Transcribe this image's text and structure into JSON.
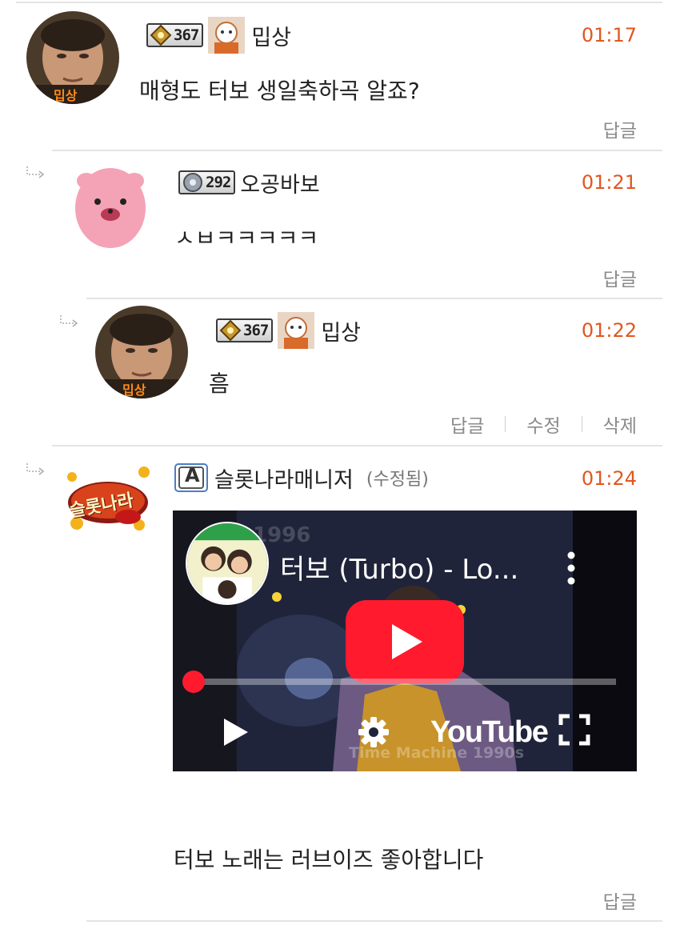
{
  "colors": {
    "time": "#e2561e",
    "text": "#222222",
    "muted": "#8a8a8a",
    "divider": "#e4e4e4",
    "youtube_red": "#ff1a2e"
  },
  "comments": [
    {
      "avatar_tag": "밉상",
      "level": "367",
      "nickname": "밉상",
      "time": "01:17",
      "text": "매형도 터보 생일축하곡 알죠?",
      "actions": [
        "답글"
      ]
    },
    {
      "level": "292",
      "nickname": "오공바보",
      "time": "01:21",
      "text": "ㅅㅂㅋㅋㅋㅋㅋ",
      "actions": [
        "답글"
      ]
    },
    {
      "avatar_tag": "밉상",
      "level": "367",
      "nickname": "밉상",
      "time": "01:22",
      "text": "흠",
      "actions": [
        "답글",
        "수정",
        "삭제"
      ]
    },
    {
      "avatar_tag": "슬롯나라",
      "admin_badge": "A",
      "nickname": "슬롯나라매니저",
      "edited": "(수정됨)",
      "time": "01:24",
      "video": {
        "title": "터보 (Turbo) - Lo...",
        "logo": "YouTube",
        "watermark": "Time Machine 1990s",
        "channel_year": "1996",
        "play_icon": "play-triangle",
        "settings_icon": "gear",
        "fullscreen_icon": "fullscreen-corners"
      },
      "text": "터보 노래는 러브이즈 좋아합니다",
      "actions": [
        "답글"
      ]
    }
  ]
}
